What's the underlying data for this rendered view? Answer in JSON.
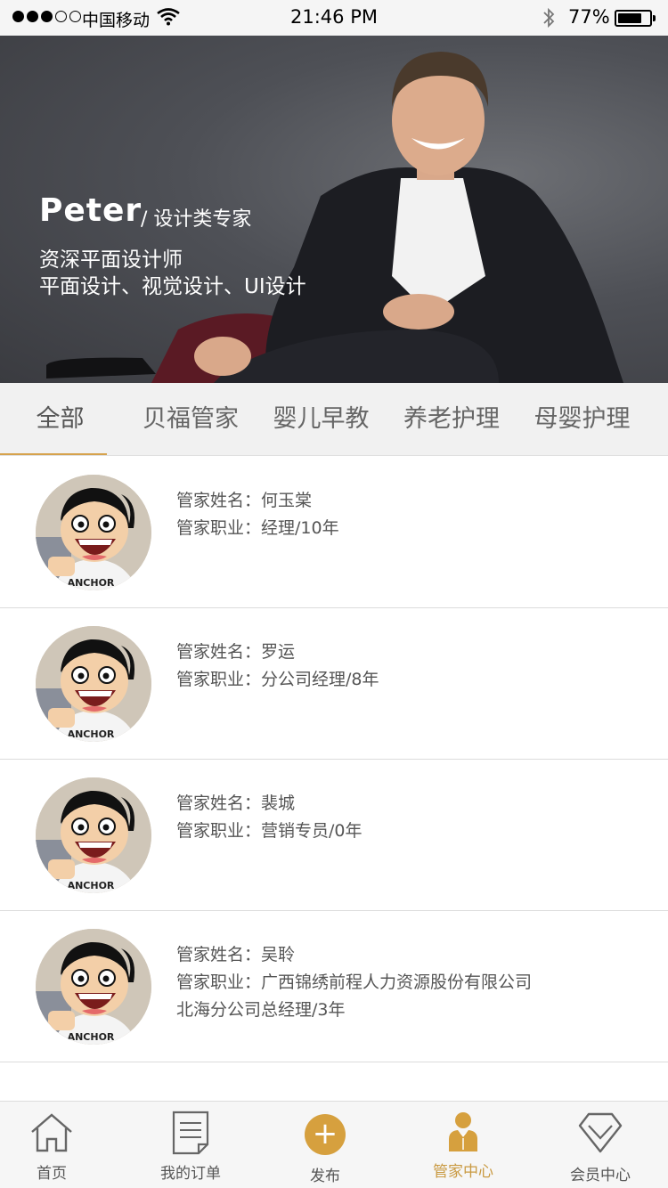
{
  "status_bar": {
    "carrier": "中国移动",
    "time": "21:46 PM",
    "battery_pct": "77%",
    "battery_level": 0.77
  },
  "banner": {
    "name": "Peter",
    "title": "/ 设计类专家",
    "line1": "资深平面设计师",
    "line2": "平面设计、视觉设计、UI设计"
  },
  "tabs": [
    {
      "label": "全部",
      "active": true
    },
    {
      "label": "贝福管家",
      "active": false
    },
    {
      "label": "婴儿早教",
      "active": false
    },
    {
      "label": "养老护理",
      "active": false
    },
    {
      "label": "母婴护理",
      "active": false
    }
  ],
  "list": [
    {
      "name_label": "管家姓名：",
      "name": "何玉棠",
      "job_label": "管家职业：",
      "job": "经理/10年",
      "job_line2": ""
    },
    {
      "name_label": "管家姓名：",
      "name": "罗运",
      "job_label": "管家职业：",
      "job": "分公司经理/8年",
      "job_line2": ""
    },
    {
      "name_label": "管家姓名：",
      "name": "裴城",
      "job_label": "管家职业：",
      "job": "营销专员/0年",
      "job_line2": ""
    },
    {
      "name_label": "管家姓名：",
      "name": "吴聆",
      "job_label": "管家职业：",
      "job": "广西锦绣前程人力资源股份有限公司",
      "job_line2": "北海分公司总经理/3年"
    }
  ],
  "tabbar": {
    "home": "首页",
    "orders": "我的订单",
    "publish": "发布",
    "butler": "管家中心",
    "member": "会员中心"
  },
  "colors": {
    "accent": "#d6a03e",
    "tab_bg": "#f1f1f1"
  }
}
